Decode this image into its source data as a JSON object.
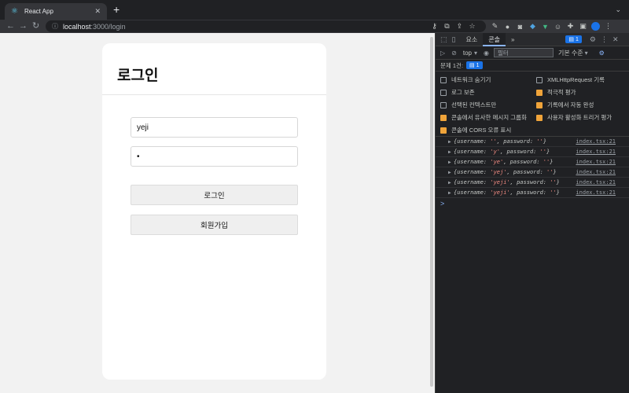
{
  "browser": {
    "tab_title": "React App",
    "new_tab": "+",
    "url_host": "localhost",
    "url_path": ":3000/login"
  },
  "page": {
    "heading": "로그인",
    "username_value": "yeji",
    "password_value": "•",
    "login_button": "로그인",
    "signup_button": "회원가입"
  },
  "devtools": {
    "tabs": [
      "요소",
      "콘솔",
      "»"
    ],
    "active_tab": "콘솔",
    "message_count": "1",
    "context": "top",
    "filter_placeholder": "필터",
    "level": "기본 수준",
    "issues_label": "문제 1건:",
    "issues_count": "1",
    "options_left": [
      {
        "label": "네트워크 숨기기",
        "checked": false
      },
      {
        "label": "로그 보존",
        "checked": false
      },
      {
        "label": "선택된 컨텍스트만",
        "checked": false
      },
      {
        "label": "콘솔에서 유사한 메시지 그룹화",
        "checked": true
      },
      {
        "label": "콘솔에 CORS 오류 표시",
        "checked": true
      }
    ],
    "options_right": [
      {
        "label": "XMLHttpRequest 기록",
        "checked": false
      },
      {
        "label": "적극적 평가",
        "checked": true
      },
      {
        "label": "기록에서 자동 완성",
        "checked": true
      },
      {
        "label": "사용자 활성화 트리거 평가",
        "checked": true
      }
    ],
    "logs": [
      {
        "username": "''",
        "password": "''",
        "source": "index.tsx:21"
      },
      {
        "username": "'y'",
        "password": "''",
        "source": "index.tsx:21"
      },
      {
        "username": "'ye'",
        "password": "''",
        "source": "index.tsx:21"
      },
      {
        "username": "'yej'",
        "password": "''",
        "source": "index.tsx:21"
      },
      {
        "username": "'yeji'",
        "password": "''",
        "source": "index.tsx:21"
      },
      {
        "username": "'yeji'",
        "password": "''",
        "source": "index.tsx:21"
      }
    ],
    "prompt": ">"
  }
}
